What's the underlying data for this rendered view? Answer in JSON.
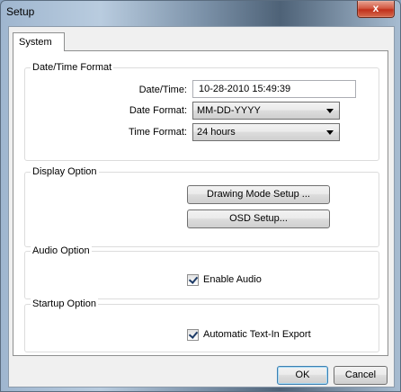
{
  "window": {
    "title": "Setup",
    "close_glyph": "x"
  },
  "tabs": [
    {
      "label": "System",
      "selected": true
    }
  ],
  "datetime": {
    "group_label": "Date/Time Format",
    "datetime_label": "Date/Time:",
    "datetime_value": "10-28-2010  15:49:39",
    "date_format_label": "Date Format:",
    "date_format_value": "MM-DD-YYYY",
    "time_format_label": "Time Format:",
    "time_format_value": "24 hours"
  },
  "display": {
    "group_label": "Display Option",
    "drawing_mode_button": "Drawing Mode Setup ...",
    "osd_button": "OSD Setup..."
  },
  "audio": {
    "group_label": "Audio Option",
    "enable_audio_label": "Enable Audio",
    "enable_audio_checked": true
  },
  "startup": {
    "group_label": "Startup Option",
    "auto_export_label": "Automatic Text-In Export",
    "auto_export_checked": true
  },
  "footer": {
    "ok_label": "OK",
    "cancel_label": "Cancel"
  }
}
